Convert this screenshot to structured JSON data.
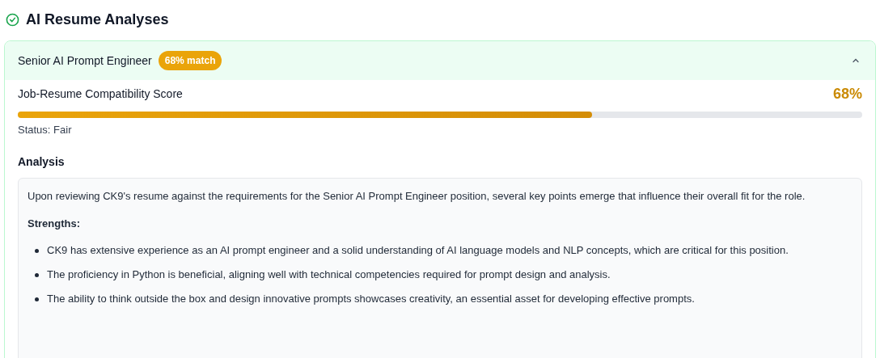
{
  "title": "AI Resume Analyses",
  "analysis_card": {
    "job_title": "Senior AI Prompt Engineer",
    "match_badge": "68% match",
    "expanded": true,
    "score_label": "Job-Resume Compatibility Score",
    "score_value": "68%",
    "level": 0.68,
    "status": "Status: Fair",
    "section_heading": "Analysis",
    "intro": "Upon reviewing CK9's resume against the requirements for the Senior AI Prompt Engineer position, several key points emerge that influence their overall fit for the role.",
    "strengths_heading": "Strengths:",
    "strengths": [
      "CK9 has extensive experience as an AI prompt engineer and a solid understanding of AI language models and NLP concepts, which are critical for this position.",
      "The proficiency in Python is beneficial, aligning well with technical competencies required for prompt design and analysis.",
      "The ability to think outside the box and design innovative prompts showcases creativity, an essential asset for developing effective prompts."
    ]
  }
}
